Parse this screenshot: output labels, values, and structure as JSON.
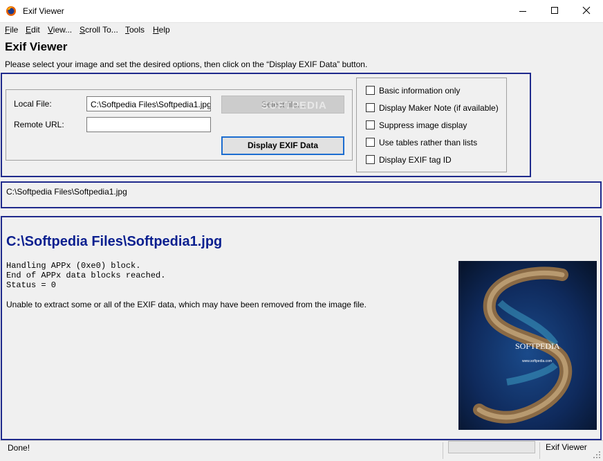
{
  "window": {
    "title": "Exif Viewer"
  },
  "menu": [
    {
      "key": "F",
      "rest": "ile"
    },
    {
      "key": "E",
      "rest": "dit"
    },
    {
      "key": "V",
      "rest": "iew..."
    },
    {
      "key": "S",
      "rest": "croll To..."
    },
    {
      "key": "T",
      "rest": "ools"
    },
    {
      "key": "H",
      "rest": "elp"
    }
  ],
  "header": {
    "title": "Exif Viewer",
    "description": "Please select your image and set the desired options, then click on the “Display EXIF Data” button."
  },
  "form": {
    "local_file_label": "Local File:",
    "local_file_value": "C:\\Softpedia Files\\Softpedia1.jpg",
    "remote_url_label": "Remote URL:",
    "remote_url_value": "",
    "select_button": "Select file...",
    "display_button": "Display EXIF Data",
    "watermark": "SOFTPEDIA"
  },
  "options": [
    {
      "label": "Basic information only",
      "checked": false
    },
    {
      "label": "Display Maker Note (if available)",
      "checked": false
    },
    {
      "label": "Suppress image display",
      "checked": false
    },
    {
      "label": "Use tables rather than lists",
      "checked": false
    },
    {
      "label": "Display EXIF tag ID",
      "checked": false
    }
  ],
  "path_display": "C:\\Softpedia Files\\Softpedia1.jpg",
  "result": {
    "title": "C:\\Softpedia Files\\Softpedia1.jpg",
    "log": [
      "Handling APPx (0xe0) block.",
      "End of APPx data blocks reached.",
      "Status = 0"
    ],
    "message": "Unable to extract some or all of the EXIF data, which may have been removed from the image file.",
    "image_caption": "SOFTPEDIA",
    "image_url_text": "www.softpedia.com"
  },
  "status": {
    "left": "Done!",
    "right": "Exif Viewer"
  },
  "colors": {
    "panel_border": "#1f2a8c",
    "result_title": "#0a1f8f",
    "accent_button_border": "#1c6dd0"
  }
}
